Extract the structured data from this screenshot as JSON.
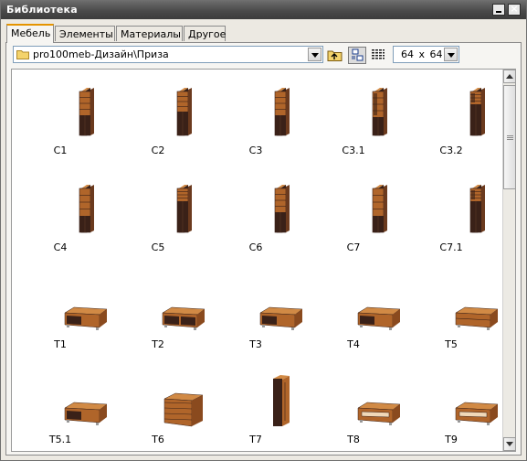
{
  "window": {
    "title": "Библиотека"
  },
  "tabs": [
    {
      "label": "Мебель",
      "active": true
    },
    {
      "label": "Элементы",
      "active": false
    },
    {
      "label": "Материалы",
      "active": false
    },
    {
      "label": "Другое",
      "active": false
    }
  ],
  "path": {
    "value": "pro100meb-Дизайн\\Приза",
    "icon": "folder-icon"
  },
  "toolbar": {
    "up_icon": "folder-up-icon",
    "view_icon": "large-icons-view-icon",
    "list_icon": "list-view-icon"
  },
  "thumb_size": {
    "value": "64 x 64"
  },
  "items": [
    {
      "label": "C1",
      "kind": "tall",
      "variant": 0
    },
    {
      "label": "C2",
      "kind": "tall",
      "variant": 1
    },
    {
      "label": "C3",
      "kind": "tall",
      "variant": 2
    },
    {
      "label": "C3.1",
      "kind": "tall",
      "variant": 3
    },
    {
      "label": "C3.2",
      "kind": "tall",
      "variant": 4
    },
    {
      "label": "C4",
      "kind": "tall",
      "variant": 5
    },
    {
      "label": "C5",
      "kind": "tall",
      "variant": 6
    },
    {
      "label": "C6",
      "kind": "tall",
      "variant": 7
    },
    {
      "label": "C7",
      "kind": "tall",
      "variant": 5
    },
    {
      "label": "C7.1",
      "kind": "tall",
      "variant": 4
    },
    {
      "label": "T1",
      "kind": "low",
      "variant": 0
    },
    {
      "label": "T2",
      "kind": "low",
      "variant": 1
    },
    {
      "label": "T3",
      "kind": "low",
      "variant": 0
    },
    {
      "label": "T4",
      "kind": "low",
      "variant": 2
    },
    {
      "label": "T5",
      "kind": "low",
      "variant": 3
    },
    {
      "label": "T5.1",
      "kind": "low",
      "variant": 2
    },
    {
      "label": "T6",
      "kind": "mid",
      "variant": 0
    },
    {
      "label": "T7",
      "kind": "tower",
      "variant": 0
    },
    {
      "label": "T8",
      "kind": "low",
      "variant": 4
    },
    {
      "label": "T9",
      "kind": "low",
      "variant": 5
    }
  ],
  "colors": {
    "wood": "#b0652a",
    "wood_light": "#d18a45",
    "dark": "#3a2118",
    "title_bar": "#4a4a4a",
    "tab_accent": "#e59400"
  }
}
